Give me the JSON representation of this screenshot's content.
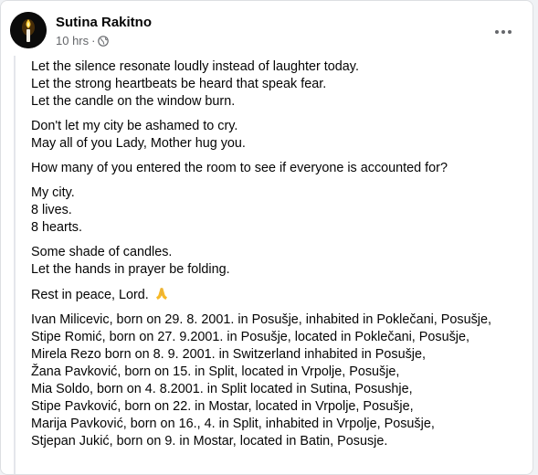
{
  "post": {
    "author": "Sutina Rakitno",
    "time": "10 hrs",
    "separator": "·",
    "privacy_icon": "globe-icon",
    "more_icon": "more-options-icon",
    "avatar_icon": "candle-icon"
  },
  "paragraphs": [
    [
      "Let the silence resonate loudly instead of laughter today.",
      "Let the strong heartbeats be heard that speak fear.",
      "Let the candle on the window burn."
    ],
    [
      "Don't let my city be ashamed to cry.",
      "May all of you Lady, Mother hug you."
    ],
    [
      "How many of you entered the room to see if everyone is accounted for?"
    ],
    [
      "My city.",
      "8 lives.",
      "8 hearts."
    ],
    [
      "Some shade of candles.",
      "Let the hands in prayer be folding."
    ],
    [
      "Rest in peace, Lord."
    ],
    [
      "Ivan Milicevic, born on 29. 8. 2001. in Posušje, inhabited in Poklečani, Posušje,",
      "Stipe Romić, born on 27. 9.2001. in Posušje, located in Poklečani, Posušje,",
      "Mirela Rezo born on 8. 9. 2001. in Switzerland inhabited in Posušje,",
      "Žana Pavković, born on 15. in Split, located in Vrpolje, Posušje,",
      "Mia Soldo, born on 4. 8.2001. in Split located in Sutina, Posushje,",
      "Stipe Pavković, born on 22. in Mostar, located in Vrpolje, Posušje,",
      "Marija Pavković, born on 16., 4. in Split, inhabited in Vrpolje, Posušje,",
      "Stjepan Jukić, born on 9. in Mostar, located in Batin, Posusje."
    ]
  ],
  "emoji": {
    "after_paragraph": 5,
    "name": "folded-hands-emoji"
  },
  "colors": {
    "text": "#050505",
    "secondary": "#65676b",
    "emoji": "#f7b928"
  }
}
